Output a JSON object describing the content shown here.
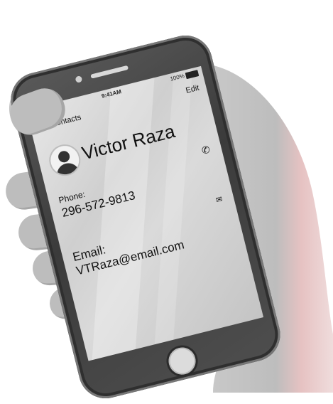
{
  "status_bar": {
    "signal": "••••",
    "time": "9:41AM",
    "battery": "100%"
  },
  "nav": {
    "back_label": "All Contacts",
    "edit_label": "Edit"
  },
  "contact": {
    "name": "Victor Raza",
    "phone_label": "Phone:",
    "phone_value": "296-572-9813",
    "email_label": "Email:",
    "email_value": "VTRaza@email.com"
  },
  "icons": {
    "wifi": "wifi-icon",
    "back": "chevron-left-icon",
    "avatar": "person-avatar-icon",
    "call": "phone-icon",
    "mail": "mail-icon",
    "home": "home-button"
  },
  "colors": {
    "phone_body": "#3b3b3b",
    "screen": "#d6d6d6",
    "text": "#111111",
    "hand": "#bdbdbd",
    "hand_tint": "#e8b8b8"
  }
}
